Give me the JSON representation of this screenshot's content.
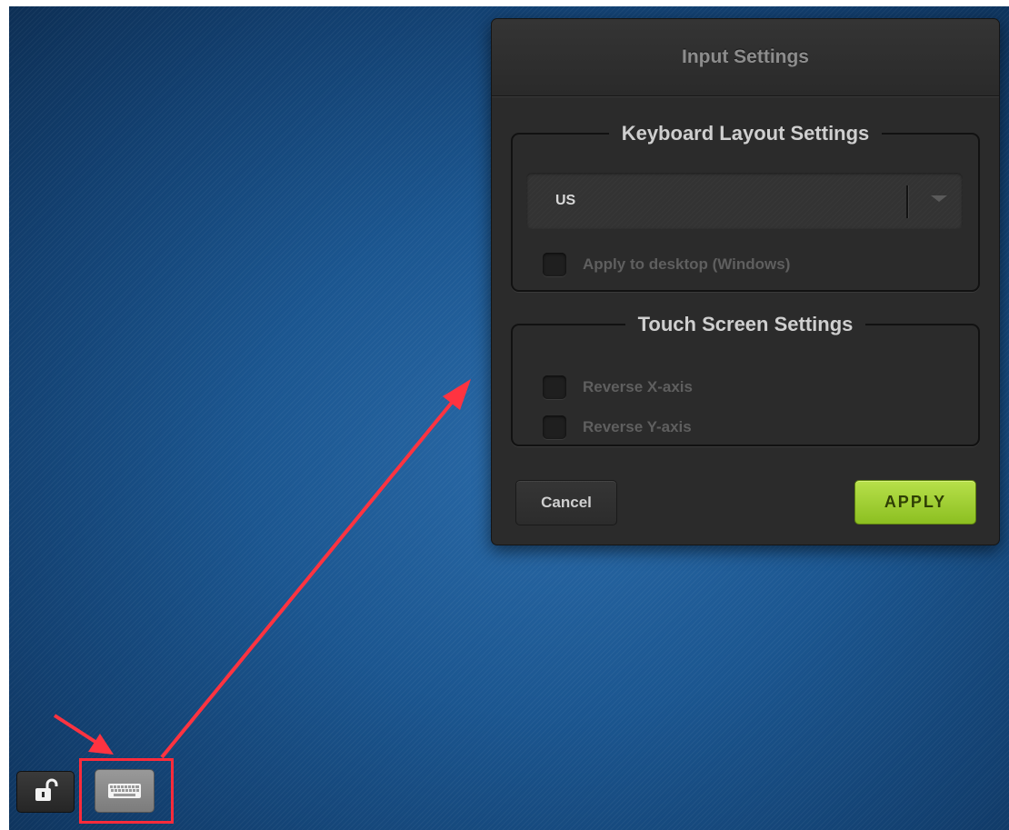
{
  "dialog": {
    "title": "Input Settings",
    "keyboard_section": {
      "legend": "Keyboard Layout Settings",
      "layout_value": "US",
      "apply_desktop_label": "Apply to desktop (Windows)",
      "apply_desktop_checked": false
    },
    "touch_section": {
      "legend": "Touch Screen Settings",
      "reverse_x_label": "Reverse X-axis",
      "reverse_x_checked": false,
      "reverse_y_label": "Reverse Y-axis",
      "reverse_y_checked": false
    },
    "cancel_label": "Cancel",
    "apply_label": "APPLY"
  },
  "toolbar": {
    "lock_icon": "unlock-icon",
    "keyboard_icon": "keyboard-icon"
  },
  "annotation": {
    "highlight_color": "#ff2b3a",
    "arrow_color": "#ff3340"
  },
  "colors": {
    "apply_green": "#a4d33a",
    "desktop_blue": "#1b5690",
    "dialog_bg": "#2b2b2b"
  }
}
